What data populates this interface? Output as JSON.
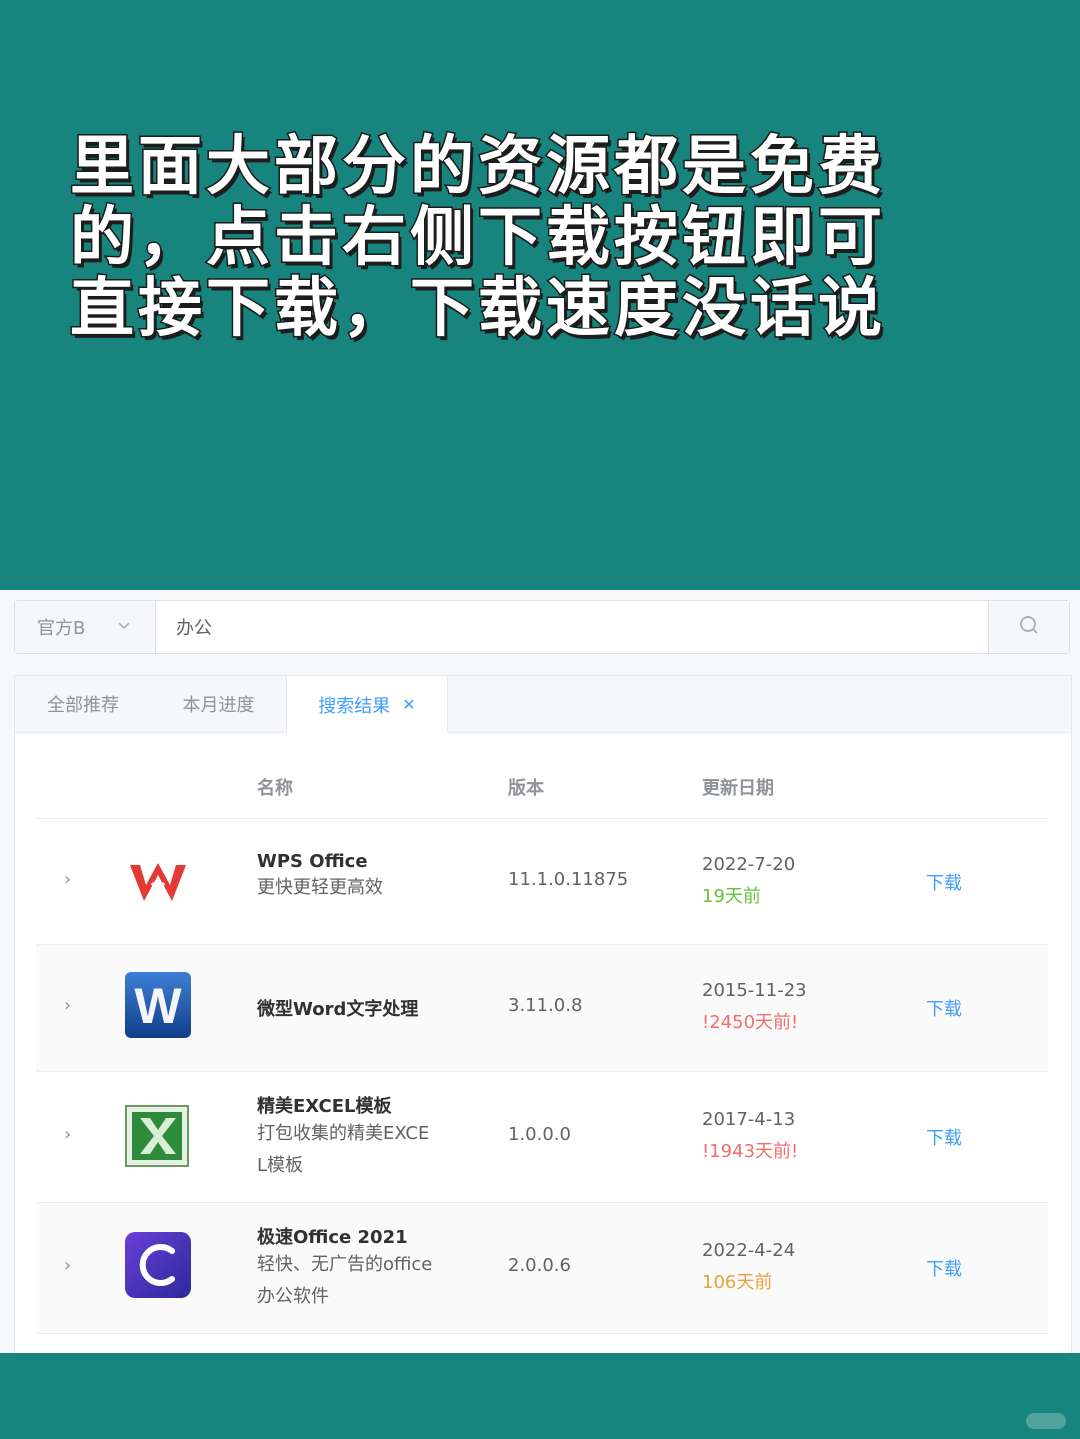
{
  "headline": {
    "line1": "里面大部分的资源都是免费",
    "line2": "的，点击右侧下载按钮即可",
    "line3": "直接下载，下载速度没话说"
  },
  "search": {
    "category": "官方B",
    "query": "办公"
  },
  "tabs": [
    {
      "label": "全部推荐"
    },
    {
      "label": "本月进度"
    },
    {
      "label": "搜索结果"
    }
  ],
  "table": {
    "headers": {
      "name": "名称",
      "version": "版本",
      "date": "更新日期"
    },
    "rows": [
      {
        "title": "WPS Office",
        "desc1": "更快更轻更高效",
        "desc2": "",
        "version": "11.1.0.11875",
        "date": "2022-7-20",
        "ago": "19天前",
        "ago_color": "#67c23a",
        "action": "下载",
        "icon": "wps-office-icon"
      },
      {
        "title": "微型Word文字处理",
        "desc1": "",
        "desc2": "",
        "version": "3.11.0.8",
        "date": "2015-11-23",
        "ago": "!2450天前!",
        "ago_color": "#f56c6c",
        "action": "下载",
        "icon": "word-icon"
      },
      {
        "title": "精美EXCEL模板",
        "desc1": "打包收集的精美EXCE",
        "desc2": "L模板",
        "version": "1.0.0.0",
        "date": "2017-4-13",
        "ago": "!1943天前!",
        "ago_color": "#f56c6c",
        "action": "下载",
        "icon": "excel-icon"
      },
      {
        "title": "极速Office 2021",
        "desc1": "轻快、无广告的office",
        "desc2": "办公软件",
        "version": "2.0.0.6",
        "date": "2022-4-24",
        "ago": "106天前",
        "ago_color": "#e6a23c",
        "action": "下载",
        "icon": "jisu-office-icon"
      }
    ]
  }
}
